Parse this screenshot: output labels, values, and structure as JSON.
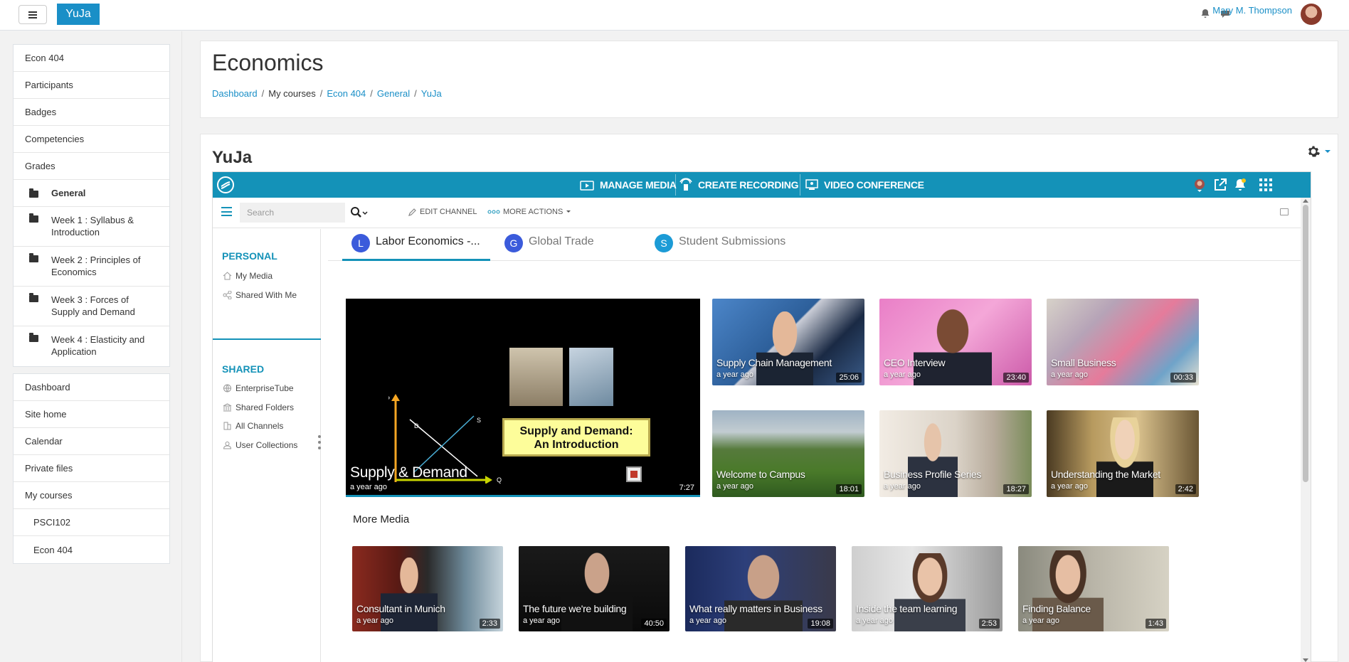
{
  "navbar": {
    "brand": "YuJa",
    "user_name": "Mary M. Thompson",
    "icons": [
      "menu-icon",
      "bell-icon",
      "chat-icon"
    ]
  },
  "drawer": {
    "course_nav": [
      {
        "label": "Econ 404"
      },
      {
        "label": "Participants"
      },
      {
        "label": "Badges"
      },
      {
        "label": "Competencies"
      },
      {
        "label": "Grades"
      },
      {
        "label": "General"
      },
      {
        "label": "Week 1 : Syllabus & Introduction"
      },
      {
        "label": "Week 2 : Principles of Economics"
      },
      {
        "label": "Week 3 : Forces of Supply and Demand"
      },
      {
        "label": "Week 4 : Elasticity and Application"
      }
    ],
    "site_nav": [
      {
        "label": "Dashboard"
      },
      {
        "label": "Site home"
      },
      {
        "label": "Calendar"
      },
      {
        "label": "Private files"
      },
      {
        "label": "My courses"
      },
      {
        "label": "PSCI102"
      },
      {
        "label": "Econ 404"
      }
    ]
  },
  "header": {
    "title": "Economics",
    "breadcrumb": [
      "Dashboard",
      "My courses",
      "Econ 404",
      "General",
      "YuJa"
    ]
  },
  "main": {
    "section_title": "YuJa"
  },
  "yuja": {
    "actions": {
      "manage_media": "MANAGE MEDIA",
      "create_recording": "CREATE RECORDING",
      "video_conference": "VIDEO CONFERENCE"
    },
    "toolbar": {
      "search_placeholder": "Search",
      "edit_channel": "EDIT CHANNEL",
      "more_actions": "MORE ACTIONS"
    },
    "sidebar": {
      "personal_heading": "PERSONAL",
      "personal_items": [
        "My Media",
        "Shared With Me"
      ],
      "shared_heading": "SHARED",
      "shared_items": [
        "EnterpriseTube",
        "Shared Folders",
        "All Channels",
        "User Collections"
      ]
    },
    "tabs": [
      {
        "initial": "L",
        "label": "Labor Economics -...",
        "color": "#3b5bdb"
      },
      {
        "initial": "G",
        "label": "Global Trade",
        "color": "#3b5bdb"
      },
      {
        "initial": "S",
        "label": "Student Submissions",
        "color": "#1c9bd6"
      }
    ],
    "featured": {
      "title": "Supply & Demand",
      "age": "a year ago",
      "duration": "7:27",
      "slide_text_1": "Supply and Demand:",
      "slide_text_2": "An Introduction",
      "graph_labels": {
        "p": "P",
        "d": "D",
        "s": "S",
        "q": "Q"
      }
    },
    "grid": [
      {
        "title": "Supply Chain Management",
        "age": "a year ago",
        "duration": "25:06"
      },
      {
        "title": "CEO Interview",
        "age": "a year ago",
        "duration": "23:40"
      },
      {
        "title": "Small Business",
        "age": "a year ago",
        "duration": "00:33"
      },
      {
        "title": "Welcome to Campus",
        "age": "a year ago",
        "duration": "18:01"
      },
      {
        "title": "Business Profile Series",
        "age": "a year ago",
        "duration": "18:27"
      },
      {
        "title": "Understanding the Market",
        "age": "a year ago",
        "duration": "2:42"
      }
    ],
    "more_media_heading": "More Media",
    "more_media": [
      {
        "title": "Consultant in Munich",
        "age": "a year ago",
        "duration": "2:33"
      },
      {
        "title": "The future we're building",
        "age": "a year ago",
        "duration": "40:50"
      },
      {
        "title": "What really matters in Business",
        "age": "a year ago",
        "duration": "19:08"
      },
      {
        "title": "Inside the team learning",
        "age": "a year ago",
        "duration": "2:53"
      },
      {
        "title": "Finding Balance",
        "age": "a year ago",
        "duration": "1:43"
      }
    ]
  },
  "colors": {
    "accent": "#1a8fc7",
    "yuja_bar": "#1492b8"
  }
}
